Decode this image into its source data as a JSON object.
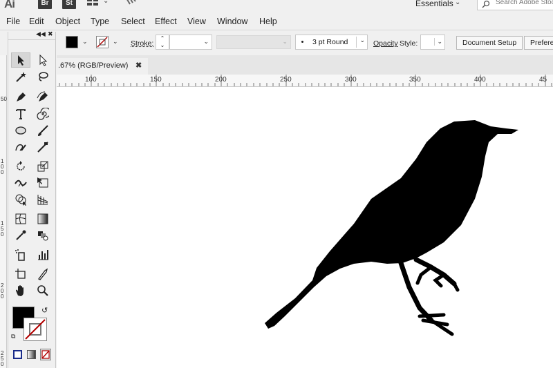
{
  "app": {
    "logo": "Ai",
    "badges": [
      "Br",
      "St"
    ],
    "workspace": "Essentials",
    "search_placeholder": "Search Adobe Stock"
  },
  "menu": [
    "File",
    "Edit",
    "Object",
    "Type",
    "Select",
    "Effect",
    "View",
    "Window",
    "Help"
  ],
  "control": {
    "stroke_label": "Stroke:",
    "brush": "3 pt Round",
    "opacity_label": "Opacity",
    "style_label": "Style:",
    "document_setup": "Document Setup",
    "preferences": "Preferences"
  },
  "document": {
    "tab_title": ".67% (RGB/Preview)",
    "close": "✖"
  },
  "ruler": {
    "h_ticks": [
      "100",
      "150",
      "200",
      "250",
      "300",
      "350",
      "400",
      "45"
    ],
    "v_ticks": [
      "50",
      "100",
      "150",
      "200",
      "250"
    ]
  },
  "colors": {
    "fill": "#000000",
    "stroke": "none",
    "accent": "#b30000"
  },
  "icons": [
    "selection",
    "direct-selection",
    "magic-wand",
    "lasso",
    "pen",
    "curvature",
    "type",
    "spiral",
    "ellipse",
    "paintbrush",
    "shaper",
    "eraser",
    "rotate",
    "scale",
    "width",
    "free-transform",
    "shape-builder",
    "perspective-grid",
    "mesh",
    "gradient",
    "eyedropper",
    "blend",
    "symbol-sprayer",
    "column-graph",
    "artboard",
    "slice",
    "hand",
    "zoom"
  ]
}
